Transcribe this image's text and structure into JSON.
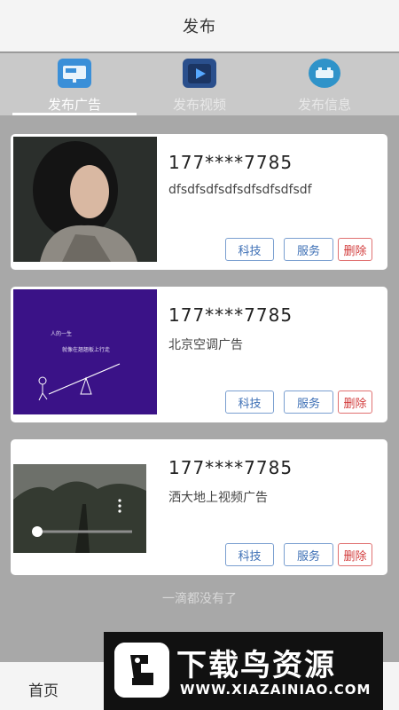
{
  "header": {
    "title": "发布"
  },
  "tabs": [
    {
      "label": "发布广告",
      "icon": "billboard-icon",
      "active": true
    },
    {
      "label": "发布视频",
      "icon": "video-play-icon",
      "active": false
    },
    {
      "label": "发布信息",
      "icon": "info-icon",
      "active": false
    }
  ],
  "cards": [
    {
      "phone": "177****7785",
      "desc": "dfsdfsdfsdfsdfsdfsdfsdf",
      "tags": [
        "科技",
        "服务"
      ],
      "delete_label": "删除",
      "media": "photo"
    },
    {
      "phone": "177****7785",
      "desc": "北京空调广告",
      "tags": [
        "科技",
        "服务"
      ],
      "delete_label": "删除",
      "media": "illustration",
      "thumb_text": {
        "line1": "人的一生",
        "line2": "就像在翘翘板上行走"
      }
    },
    {
      "phone": "177****7785",
      "desc": "洒大地上视频广告",
      "tags": [
        "科技",
        "服务"
      ],
      "delete_label": "删除",
      "media": "video"
    }
  ],
  "footer_text": "一滴都没有了",
  "bottom_nav": {
    "home_label": "首页"
  },
  "watermark": {
    "title": "下载鸟资源",
    "url": "WWW.XIAZAINIAO.COM"
  },
  "colors": {
    "tag_blue": "#3d6fb5",
    "delete_red": "#d23b3b",
    "overlay_gray": "#a8a8a8"
  }
}
